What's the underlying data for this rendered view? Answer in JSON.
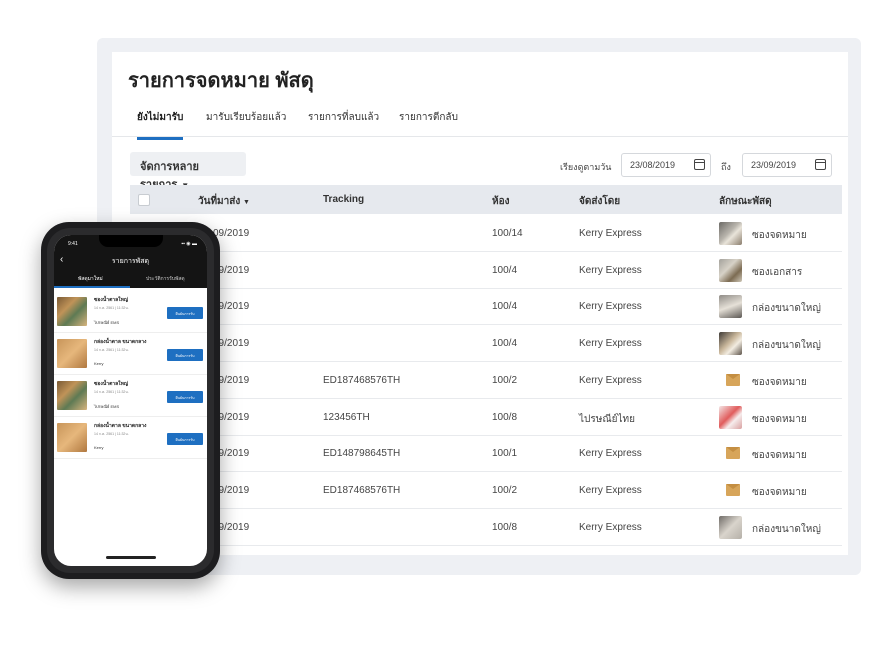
{
  "page": {
    "title": "รายการจดหมาย พัสดุ"
  },
  "tabs": [
    "ยังไม่มารับ",
    "มารับเรียบร้อยแล้ว",
    "รายการที่ลบแล้ว",
    "รายการตีกลับ"
  ],
  "toolbar": {
    "bulk_label": "จัดการหลายรายการ",
    "sort_label": "เรียงดูตามวัน",
    "date_from": "23/08/2019",
    "to_label": "ถึง",
    "date_to": "23/09/2019"
  },
  "table": {
    "headers": {
      "date": "วันที่มาส่ง",
      "tracking": "Tracking",
      "room": "ห้อง",
      "sender": "จัดส่งโดย",
      "type": "ลักษณะพัสดุ"
    },
    "rows": [
      {
        "date": "09/2019",
        "tracking": "",
        "room": "100/14",
        "sender": "Kerry Express",
        "type": "ซองจดหมาย",
        "thumb": "photo-a"
      },
      {
        "date": "09/2019",
        "tracking": "",
        "room": "100/4",
        "sender": "Kerry Express",
        "type": "ซองเอกสาร",
        "thumb": "photo-b"
      },
      {
        "date": "09/2019",
        "tracking": "",
        "room": "100/4",
        "sender": "Kerry Express",
        "type": "กล่องขนาดใหญ่",
        "thumb": "photo-c"
      },
      {
        "date": "09/2019",
        "tracking": "",
        "room": "100/4",
        "sender": "Kerry Express",
        "type": "กล่องขนาดใหญ่",
        "thumb": "photo-d"
      },
      {
        "date": "09/2019",
        "tracking": "ED187468576TH",
        "room": "100/2",
        "sender": "Kerry Express",
        "type": "ซองจดหมาย",
        "thumb": "letter"
      },
      {
        "date": "09/2019",
        "tracking": "123456TH",
        "room": "100/8",
        "sender": "ไปรษณีย์ไทย",
        "type": "ซองจดหมาย",
        "thumb": "photo-e"
      },
      {
        "date": "09/2019",
        "tracking": "ED148798645TH",
        "room": "100/1",
        "sender": "Kerry Express",
        "type": "ซองจดหมาย",
        "thumb": "letter"
      },
      {
        "date": "09/2019",
        "tracking": "ED187468576TH",
        "room": "100/2",
        "sender": "Kerry Express",
        "type": "ซองจดหมาย",
        "thumb": "letter"
      },
      {
        "date": "09/2019",
        "tracking": "",
        "room": "100/8",
        "sender": "Kerry Express",
        "type": "กล่องขนาดใหญ่",
        "thumb": "photo-f"
      }
    ]
  },
  "phone": {
    "time": "9:41",
    "title": "รายการพัสดุ",
    "tabs": [
      "พัสดุมาใหม่",
      "ประวัติการรับพัสดุ"
    ],
    "items": [
      {
        "name": "ซองน้ำตาลใหญ่",
        "date": "14 ก.ค. 2561 | 11:32น.",
        "courier": "ไปรษณีย์ EMS",
        "button": "ยืนยันการรับ",
        "img": "env"
      },
      {
        "name": "กล่องน้ำตาล ขนาดกลาง",
        "date": "14 ก.ค. 2561 | 11:32น.",
        "courier": "Kerry",
        "button": "ยืนยันการรับ",
        "img": "box"
      },
      {
        "name": "ซองน้ำตาลใหญ่",
        "date": "14 ก.ค. 2561 | 11:32น.",
        "courier": "ไปรษณีย์ EMS",
        "button": "ยืนยันการรับ",
        "img": "env"
      },
      {
        "name": "กล่องน้ำตาล ขนาดกลาง",
        "date": "14 ก.ค. 2561 | 11:32น.",
        "courier": "Kerry",
        "button": "ยืนยันการรับ",
        "img": "box"
      }
    ]
  },
  "colors": {
    "accent": "#1e6fc1",
    "header_bg": "#e6e9ee",
    "frame_bg": "#eef0f4"
  }
}
